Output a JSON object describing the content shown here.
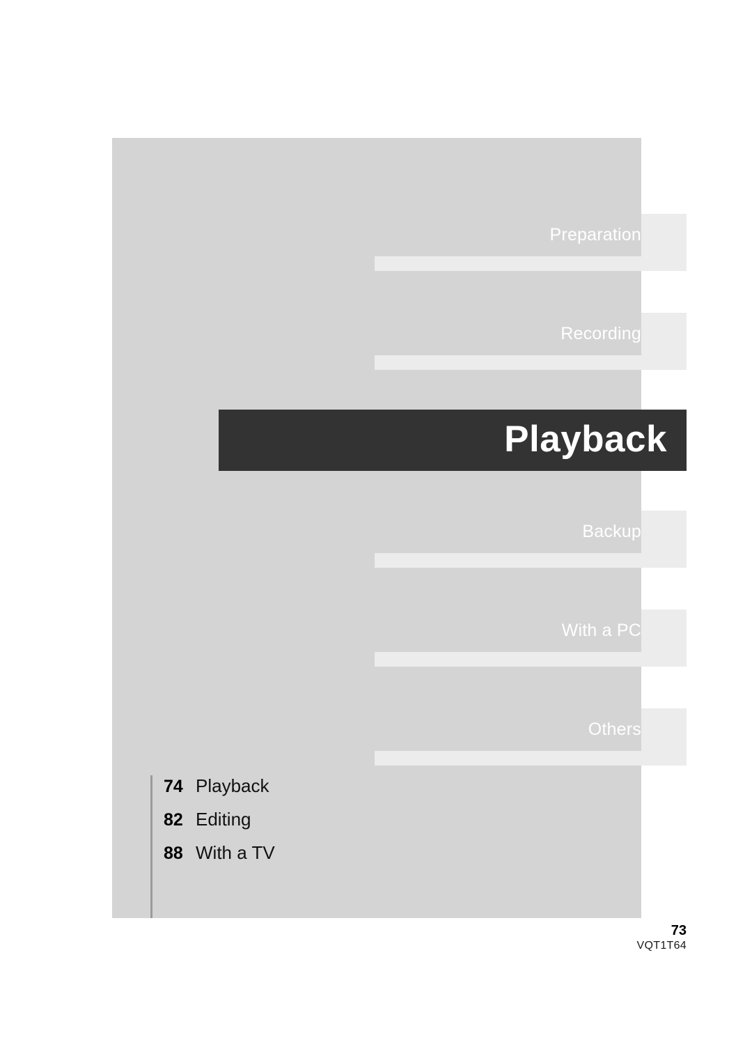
{
  "page": {
    "current_section": "Playback",
    "page_number": "73",
    "document_code": "VQT1T64"
  },
  "colors": {
    "panel_background": "#d4d4d4",
    "tab_background": "#ececec",
    "current_banner": "#333333",
    "banner_text": "#ffffff",
    "tab_text": "#ffffff",
    "rule": "#9b9b9b",
    "sheet": "#ffffff"
  },
  "section_tabs": [
    {
      "label": "Preparation",
      "active": false
    },
    {
      "label": "Recording",
      "active": false
    },
    {
      "label": "Playback",
      "active": true
    },
    {
      "label": "Backup",
      "active": false
    },
    {
      "label": "With a PC",
      "active": false
    },
    {
      "label": "Others",
      "active": false
    }
  ],
  "contents": [
    {
      "page": "74",
      "title": "Playback"
    },
    {
      "page": "82",
      "title": "Editing"
    },
    {
      "page": "88",
      "title": "With a TV"
    }
  ]
}
